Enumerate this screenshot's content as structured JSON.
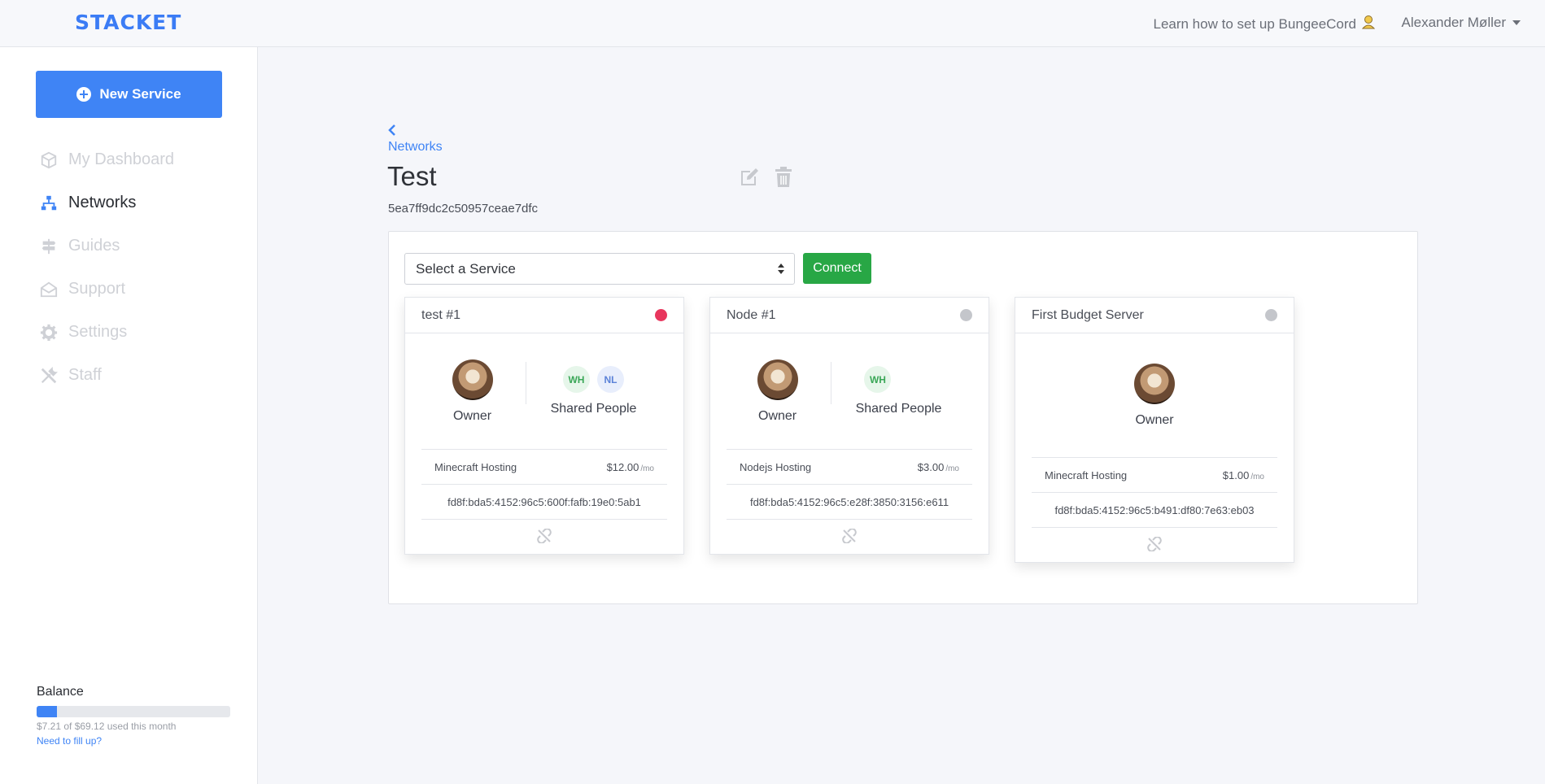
{
  "brand": {
    "logo": "STACKET",
    "accent": "#3f84f5"
  },
  "topbar": {
    "help_link": "Learn how to set up BungeeCord",
    "user_name": "Alexander Møller"
  },
  "sidebar": {
    "new_service_label": "New Service",
    "items": [
      {
        "label": "My Dashboard",
        "icon": "box-icon",
        "active": false
      },
      {
        "label": "Networks",
        "icon": "network-icon",
        "active": true
      },
      {
        "label": "Guides",
        "icon": "signpost-icon",
        "active": false
      },
      {
        "label": "Support",
        "icon": "envelope-open-icon",
        "active": false
      },
      {
        "label": "Settings",
        "icon": "gear-icon",
        "active": false
      },
      {
        "label": "Staff",
        "icon": "tools-icon",
        "active": false
      }
    ],
    "balance": {
      "label": "Balance",
      "used_text": "$7.21 of $69.12 used this month",
      "used_fraction": 0.104,
      "fill_link": "Need to fill up?"
    }
  },
  "main": {
    "breadcrumb": "Networks",
    "title": "Test",
    "network_id": "5ea7ff9dc2c50957ceae7dfc",
    "select_placeholder": "Select a Service",
    "connect_label": "Connect",
    "cards": [
      {
        "name": "test #1",
        "status_color": "#e8365d",
        "owner_label": "Owner",
        "shared_label": "Shared People",
        "shared": [
          {
            "initials": "WH",
            "tone": "green"
          },
          {
            "initials": "NL",
            "tone": "blue"
          }
        ],
        "service_type": "Minecraft Hosting",
        "price": "$12.00",
        "price_unit": "/mo",
        "address": "fd8f:bda5:4152:96c5:600f:fafb:19e0:5ab1"
      },
      {
        "name": "Node #1",
        "status_color": "#c4c6cb",
        "owner_label": "Owner",
        "shared_label": "Shared People",
        "shared": [
          {
            "initials": "WH",
            "tone": "green"
          }
        ],
        "service_type": "Nodejs Hosting",
        "price": "$3.00",
        "price_unit": "/mo",
        "address": "fd8f:bda5:4152:96c5:e28f:3850:3156:e611"
      },
      {
        "name": "First Budget Server",
        "status_color": "#c4c6cb",
        "owner_label": "Owner",
        "service_type": "Minecraft Hosting",
        "price": "$1.00",
        "price_unit": "/mo",
        "address": "fd8f:bda5:4152:96c5:b491:df80:7e63:eb03"
      }
    ]
  }
}
